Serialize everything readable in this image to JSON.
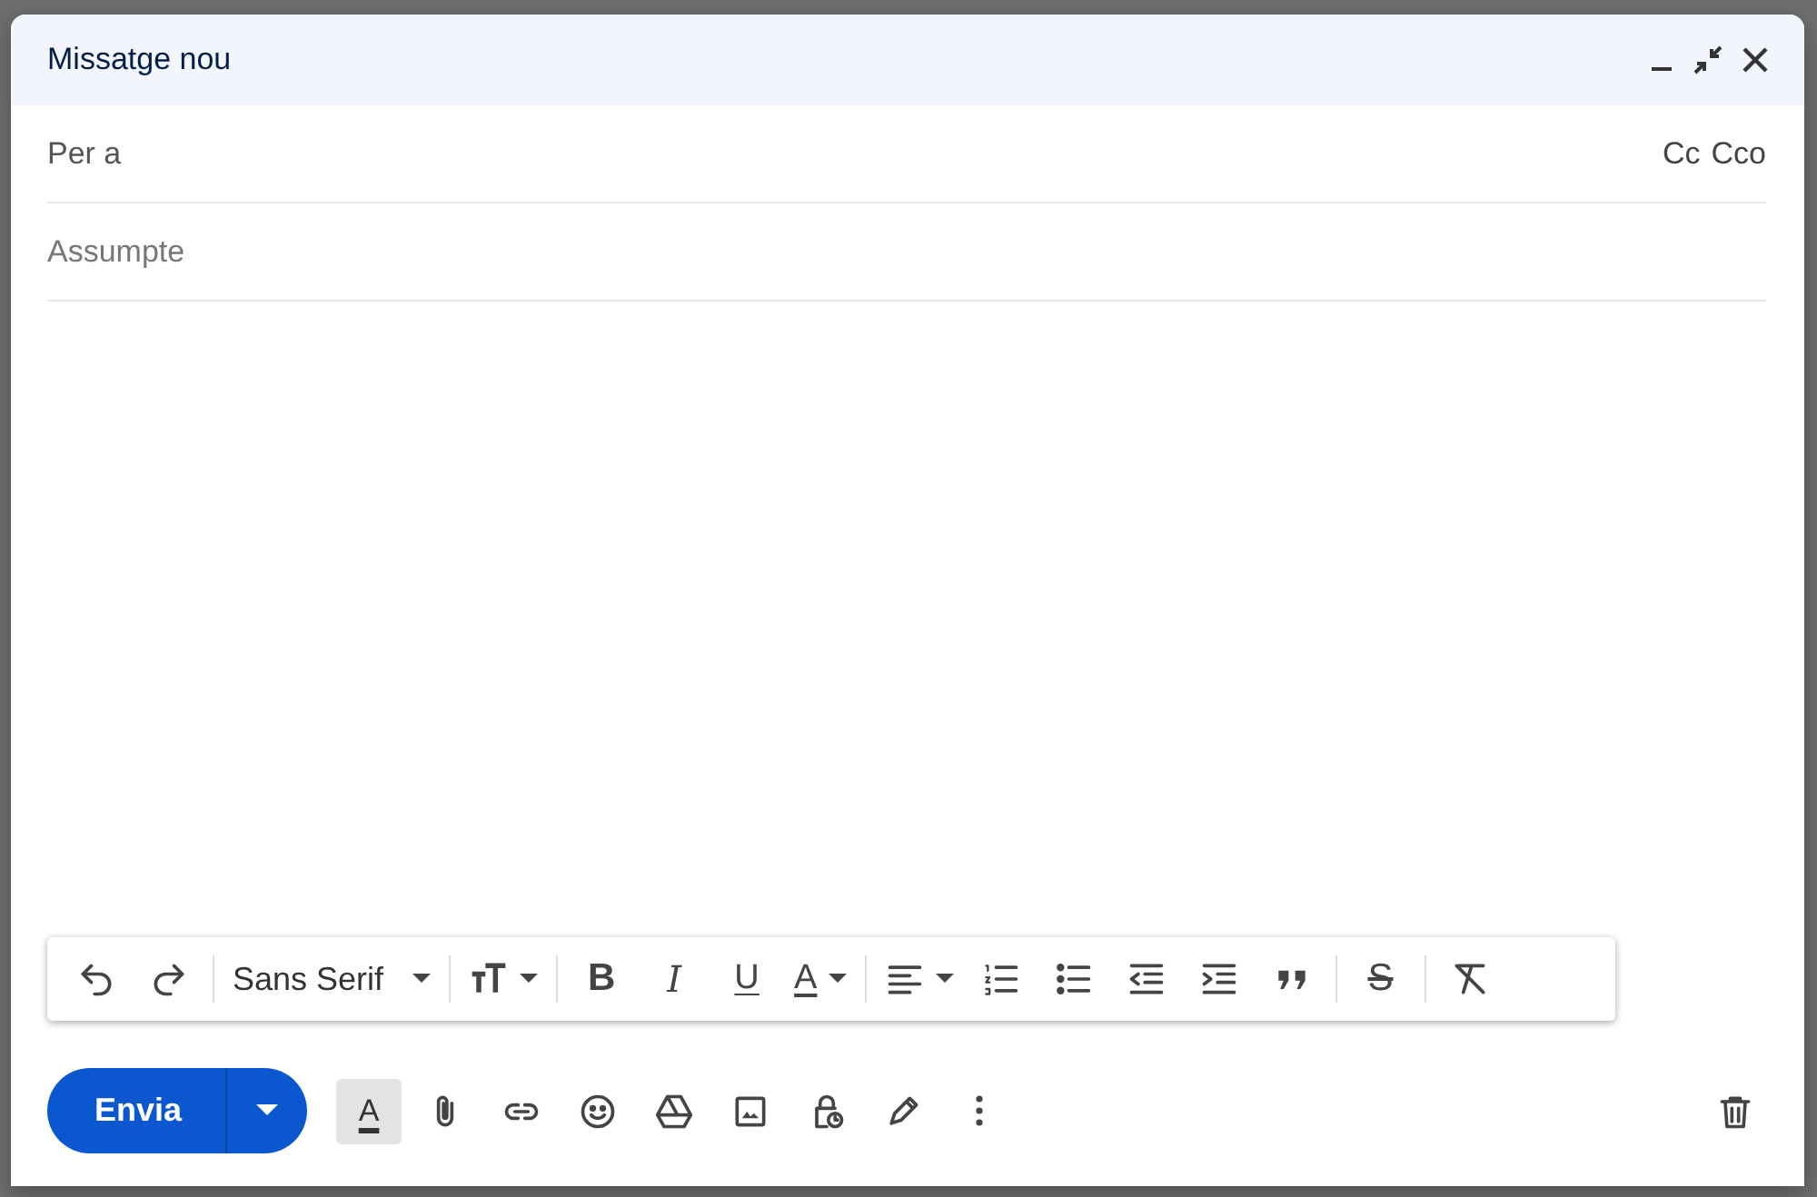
{
  "window": {
    "title": "Missatge nou"
  },
  "recipients": {
    "placeholder": "Per a",
    "cc": "Cc",
    "bcc": "Cco"
  },
  "subject": {
    "placeholder": "Assumpte"
  },
  "format_toolbar": {
    "font": "Sans Serif",
    "bold": "B",
    "italic": "I",
    "underline": "U",
    "text_color": "A",
    "strikethrough": "S"
  },
  "send_button": {
    "label": "Envia"
  },
  "formatting_toggle": {
    "label": "A",
    "selected": true
  }
}
